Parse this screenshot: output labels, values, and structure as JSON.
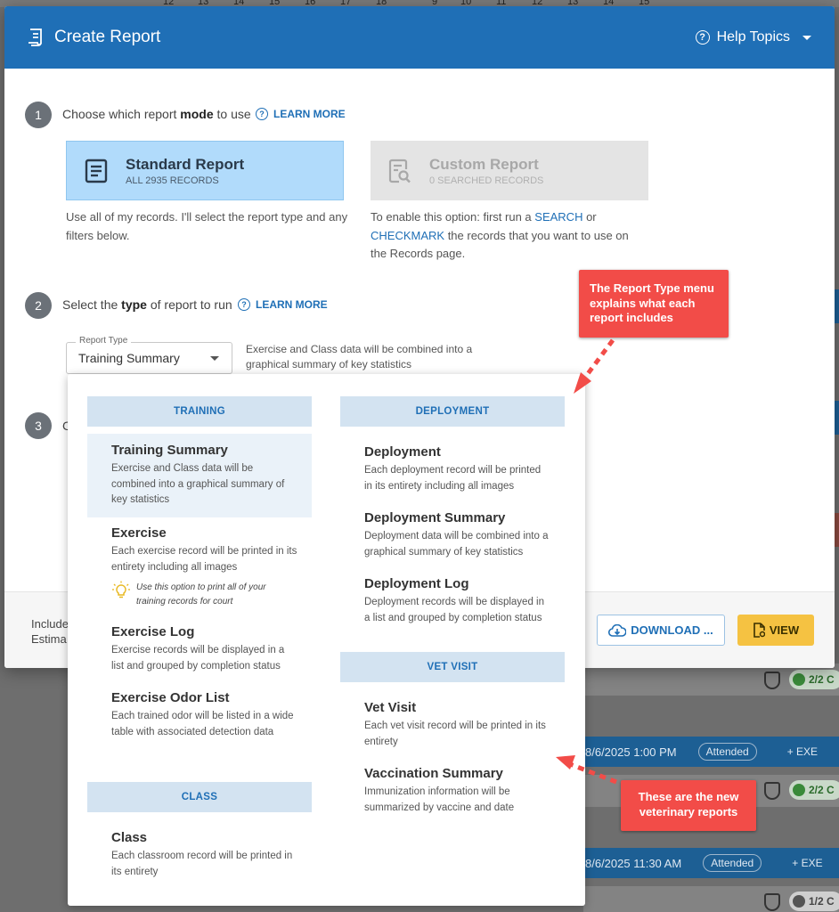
{
  "background": {
    "ruler_numbers": [
      "12",
      "13",
      "14",
      "15",
      "16",
      "17",
      "18",
      "9",
      "10",
      "11",
      "12",
      "13",
      "14",
      "15"
    ],
    "rows": [
      {
        "date": "8/6/2025 1:00 PM",
        "status": "Attended",
        "action": "+ EXE",
        "pill": "2/2 C"
      },
      {
        "date": "8/6/2025 11:30 AM",
        "status": "Attended",
        "action": "+ EXE",
        "pill": "1/2 C"
      }
    ],
    "top_pill": "2/2 C"
  },
  "header": {
    "title": "Create Report",
    "help_label": "Help Topics",
    "title_icon": "report-icon",
    "help_icon": "question-circle-icon"
  },
  "steps": [
    {
      "number": "1",
      "prefix": "Choose which report ",
      "bold": "mode",
      "suffix": " to use",
      "learn_more": "LEARN MORE"
    },
    {
      "number": "2",
      "prefix": "Select the ",
      "bold": "type",
      "suffix": " of report to run",
      "learn_more": "LEARN MORE"
    },
    {
      "number": "3",
      "partial": "C"
    }
  ],
  "modes": {
    "standard": {
      "title": "Standard Report",
      "subtitle": "ALL 2935 RECORDS",
      "description": "Use all of my records. I'll select the report type and any filters below."
    },
    "custom": {
      "title": "Custom Report",
      "subtitle": "0 SEARCHED RECORDS",
      "desc_part1": "To enable this option: first run a ",
      "desc_link1": "SEARCH",
      "desc_part2": " or ",
      "desc_link2": "CHECKMARK",
      "desc_part3": " the records that you want to use on the Records page."
    }
  },
  "report_type": {
    "label": "Report Type",
    "value": "Training Summary",
    "description": "Exercise and Class data will be combined into a graphical summary of key statistics"
  },
  "menu": {
    "categories": {
      "training": "TRAINING",
      "class": "CLASS",
      "deployment": "DEPLOYMENT",
      "vet": "VET VISIT"
    },
    "training_items": [
      {
        "name": "Training Summary",
        "desc": "Exercise and Class data will be combined into a graphical summary of key statistics"
      },
      {
        "name": "Exercise",
        "desc": "Each exercise record will be printed in its entirety including all images",
        "tip": "Use this option to print all of your training records for court"
      },
      {
        "name": "Exercise Log",
        "desc": "Exercise records will be displayed in a list and grouped by completion status"
      },
      {
        "name": "Exercise Odor List",
        "desc": "Each trained odor will be listed in a wide table with associated detection data"
      }
    ],
    "class_items": [
      {
        "name": "Class",
        "desc": "Each classroom record will be printed in its entirety"
      }
    ],
    "deployment_items": [
      {
        "name": "Deployment",
        "desc": "Each deployment record will be printed in its entirety including all images"
      },
      {
        "name": "Deployment Summary",
        "desc": "Deployment data will be combined into a graphical summary of key statistics"
      },
      {
        "name": "Deployment Log",
        "desc": "Deployment records will be displayed in a list and grouped by completion status"
      }
    ],
    "vet_items": [
      {
        "name": "Vet Visit",
        "desc": "Each vet visit record will be printed in its entirety"
      },
      {
        "name": "Vaccination Summary",
        "desc": "Immunization information will be summarized by vaccine and date"
      }
    ]
  },
  "footer": {
    "line1": "Include",
    "line2": "Estima",
    "download_label": "DOWNLOAD ...",
    "view_label": "VIEW"
  },
  "callouts": {
    "report_type": "The Report Type menu explains what each report includes",
    "vet": "These are the new veterinary reports"
  },
  "colors": {
    "header": "#1f6fb6",
    "standard_card": "#b1dbfb",
    "category": "#d3e3f1",
    "view_button": "#f5c242",
    "callout": "#f24c48"
  }
}
